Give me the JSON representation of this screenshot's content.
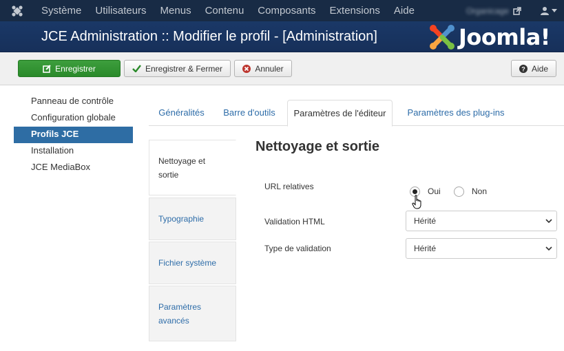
{
  "topbar": {
    "menu": [
      "Système",
      "Utilisateurs",
      "Menus",
      "Contenu",
      "Composants",
      "Extensions",
      "Aide"
    ],
    "site_name": "Organicage"
  },
  "header": {
    "title": "JCE Administration :: Modifier le profil - [Administration]",
    "logo_text": "Joomla!"
  },
  "toolbar": {
    "save_label": "Enregistrer",
    "save_close_label": "Enregistrer & Fermer",
    "cancel_label": "Annuler",
    "help_label": "Aide"
  },
  "sidebar": {
    "items": [
      {
        "label": "Panneau de contrôle",
        "active": false
      },
      {
        "label": "Configuration globale",
        "active": false
      },
      {
        "label": "Profils JCE",
        "active": true
      },
      {
        "label": "Installation",
        "active": false
      },
      {
        "label": "JCE MediaBox",
        "active": false
      }
    ]
  },
  "tabs": [
    "Généralités",
    "Barre d'outils",
    "Paramètres de l'éditeur",
    "Paramètres des plug-ins"
  ],
  "active_tab": "Paramètres de l'éditeur",
  "vtabs": [
    "Nettoyage et sortie",
    "Typographie",
    "Fichier système",
    "Paramètres avancés"
  ],
  "active_vtab": "Nettoyage et sortie",
  "section": {
    "title": "Nettoyage et sortie",
    "url_relatives": {
      "label": "URL relatives",
      "options": [
        "Oui",
        "Non"
      ],
      "selected": "Oui"
    },
    "validation_html": {
      "label": "Validation HTML",
      "value": "Hérité"
    },
    "type_validation": {
      "label": "Type de validation",
      "value": "Hérité"
    }
  },
  "colors": {
    "topbar": "#182b45",
    "header": "#1a3867",
    "save_button": "#2e8b2e",
    "active_sidebar": "#2e6da4",
    "link": "#2d6ca8"
  }
}
